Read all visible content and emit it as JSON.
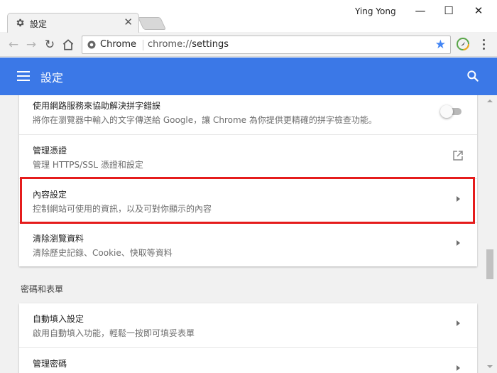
{
  "window": {
    "profile_name": "Ying Yong",
    "minimize_glyph": "—",
    "maximize_glyph": "☐",
    "close_glyph": "✕"
  },
  "tab": {
    "title": "設定",
    "icon": "gear-icon",
    "close_glyph": "✕"
  },
  "toolbar": {
    "back_glyph": "←",
    "forward_glyph": "→",
    "reload_glyph": "↻",
    "home_icon": "home-icon",
    "site_chip": "Chrome",
    "url_scheme": "chrome://",
    "url_path": "settings",
    "star_glyph": "★"
  },
  "header": {
    "title": "設定",
    "menu_icon": "hamburger-icon",
    "search_icon": "search-icon",
    "color": "#3b78e7"
  },
  "privacy_card": {
    "rows": [
      {
        "title": "使用網路服務來協助解決拼字錯誤",
        "subtitle": "將你在瀏覽器中輸入的文字傳送給 Google，讓 Chrome 為你提供更精確的拼字檢查功能。",
        "control": "toggle",
        "toggle_on": false
      },
      {
        "title": "管理憑證",
        "subtitle": "管理 HTTPS/SSL 憑證和設定",
        "control": "external-link"
      },
      {
        "title": "內容設定",
        "subtitle": "控制網站可使用的資訊，以及可對你顯示的內容",
        "control": "chevron"
      },
      {
        "title": "清除瀏覽資料",
        "subtitle": "清除歷史記錄、Cookie、快取等資料",
        "control": "chevron"
      }
    ]
  },
  "passwords_section": {
    "title": "密碼和表單",
    "rows": [
      {
        "title": "自動填入設定",
        "subtitle": "啟用自動填入功能，輕鬆一按即可填妥表單",
        "control": "chevron"
      },
      {
        "title": "管理密碼",
        "subtitle": "",
        "control": "chevron"
      }
    ]
  },
  "colors": {
    "highlight": "#e51c1c",
    "accent": "#4285f4"
  }
}
